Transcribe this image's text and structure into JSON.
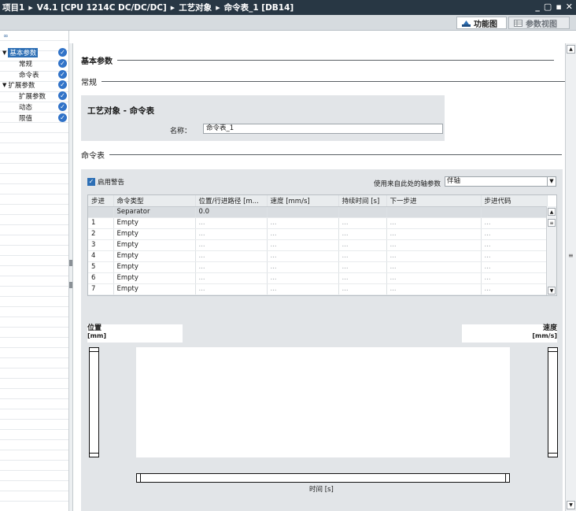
{
  "titlebar": {
    "crumbs": [
      "项目1",
      "V4.1 [CPU 1214C DC/DC/DC]",
      "工艺对象",
      "命令表_1 [DB14]"
    ],
    "window_buttons": [
      "_",
      "▢",
      "▪",
      "✕"
    ]
  },
  "viewbar": {
    "tabs": [
      {
        "label": "功能图",
        "active": true,
        "icon": "function-view-icon"
      },
      {
        "label": "参数视图",
        "active": false,
        "icon": "parameter-view-icon"
      }
    ]
  },
  "nav": {
    "items": [
      {
        "label": "基本参数",
        "level": 0,
        "expanded": true,
        "selected": true,
        "valid": true
      },
      {
        "label": "常规",
        "level": 1,
        "valid": true
      },
      {
        "label": "命令表",
        "level": 1,
        "valid": true
      },
      {
        "label": "扩展参数",
        "level": 0,
        "expanded": true,
        "valid": true
      },
      {
        "label": "扩展参数",
        "level": 1,
        "valid": true
      },
      {
        "label": "动态",
        "level": 1,
        "valid": true
      },
      {
        "label": "限值",
        "level": 1,
        "valid": true
      }
    ]
  },
  "main": {
    "section_basic": "基本参数",
    "section_general": "常规",
    "card": {
      "title": "工艺对象 - 命令表",
      "name_label": "名称：",
      "name_value": "命令表_1"
    },
    "section_cmdtable": "命令表",
    "enable_warning": {
      "label": "启用警告",
      "checked": true
    },
    "axis_param": {
      "label": "使用来自此处的轴参数",
      "value": "伴轴"
    },
    "table": {
      "headers": [
        "步进",
        "命令类型",
        "位置/行进路径 [m...",
        "速度 [mm/s]",
        "持续时间 [s]",
        "下一步进",
        "步进代码"
      ],
      "rows": [
        [
          "",
          "Separator",
          "0.0",
          "",
          "",
          "",
          ""
        ],
        [
          "1",
          "Empty",
          "...",
          "...",
          "...",
          "...",
          "..."
        ],
        [
          "2",
          "Empty",
          "...",
          "...",
          "...",
          "...",
          "..."
        ],
        [
          "3",
          "Empty",
          "...",
          "...",
          "...",
          "...",
          "..."
        ],
        [
          "4",
          "Empty",
          "...",
          "...",
          "...",
          "...",
          "..."
        ],
        [
          "5",
          "Empty",
          "...",
          "...",
          "...",
          "...",
          "..."
        ],
        [
          "6",
          "Empty",
          "...",
          "...",
          "...",
          "...",
          "..."
        ],
        [
          "7",
          "Empty",
          "...",
          "...",
          "...",
          "...",
          "..."
        ]
      ]
    },
    "chart": {
      "y_left_title": "位置",
      "y_left_unit": "[mm]",
      "y_right_title": "速度",
      "y_right_unit": "[mm/s]",
      "x_label": "时间 [s]"
    }
  }
}
